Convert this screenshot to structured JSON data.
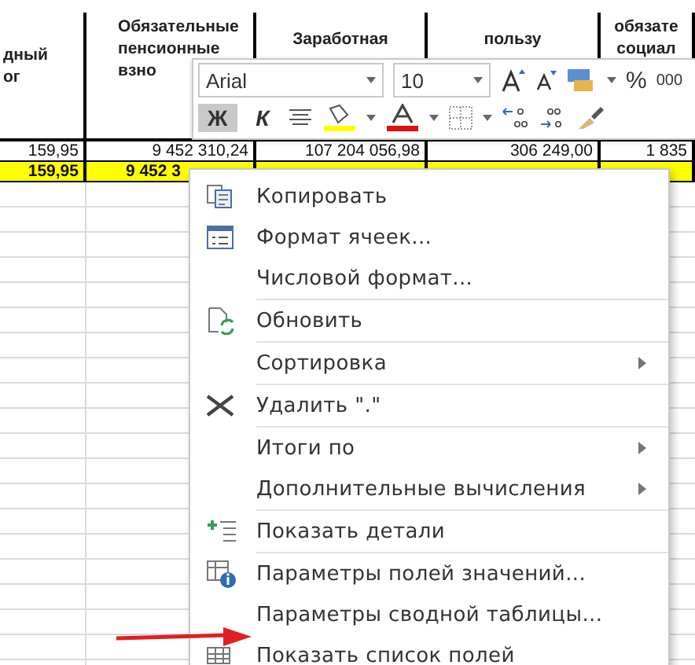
{
  "sheet": {
    "headers": [
      "дный\nог",
      "Обязательные\nпенсионные\nвзно",
      "Заработная",
      "пользу",
      "обязате\nсоциал"
    ],
    "rows": [
      {
        "selected": false,
        "cells": [
          "159,95",
          "9 452 310,24",
          "107 204 056,98",
          "306 249,00",
          "1 835"
        ]
      },
      {
        "selected": true,
        "cells": [
          "159,95",
          "9 452 3"
        ]
      }
    ]
  },
  "toolbar": {
    "font": "Arial",
    "size": "10",
    "percent": "%",
    "thousands": "000",
    "bold": {
      "label": "Ж",
      "on": true
    },
    "italic": {
      "label": "К",
      "on": false
    }
  },
  "menu": [
    {
      "kind": "item",
      "label": "Копировать",
      "submenu": false
    },
    {
      "kind": "item",
      "label": "Формат ячеек...",
      "submenu": false
    },
    {
      "kind": "item",
      "label": "Числовой формат...",
      "submenu": false
    },
    {
      "kind": "separator"
    },
    {
      "kind": "item",
      "label": "Обновить",
      "submenu": false
    },
    {
      "kind": "separator"
    },
    {
      "kind": "item",
      "label": "Сортировка",
      "submenu": true
    },
    {
      "kind": "separator"
    },
    {
      "kind": "item",
      "label": "Удалить \".\"",
      "submenu": false
    },
    {
      "kind": "separator"
    },
    {
      "kind": "item",
      "label": "Итоги по",
      "submenu": true
    },
    {
      "kind": "item",
      "label": "Дополнительные вычисления",
      "submenu": true
    },
    {
      "kind": "separator"
    },
    {
      "kind": "item",
      "label": "Показать детали",
      "submenu": false
    },
    {
      "kind": "separator"
    },
    {
      "kind": "item",
      "label": "Параметры полей значений...",
      "submenu": false
    },
    {
      "kind": "item",
      "label": "Параметры сводной таблицы...",
      "submenu": false
    },
    {
      "kind": "item",
      "label": "Показать список полей",
      "submenu": false
    }
  ]
}
